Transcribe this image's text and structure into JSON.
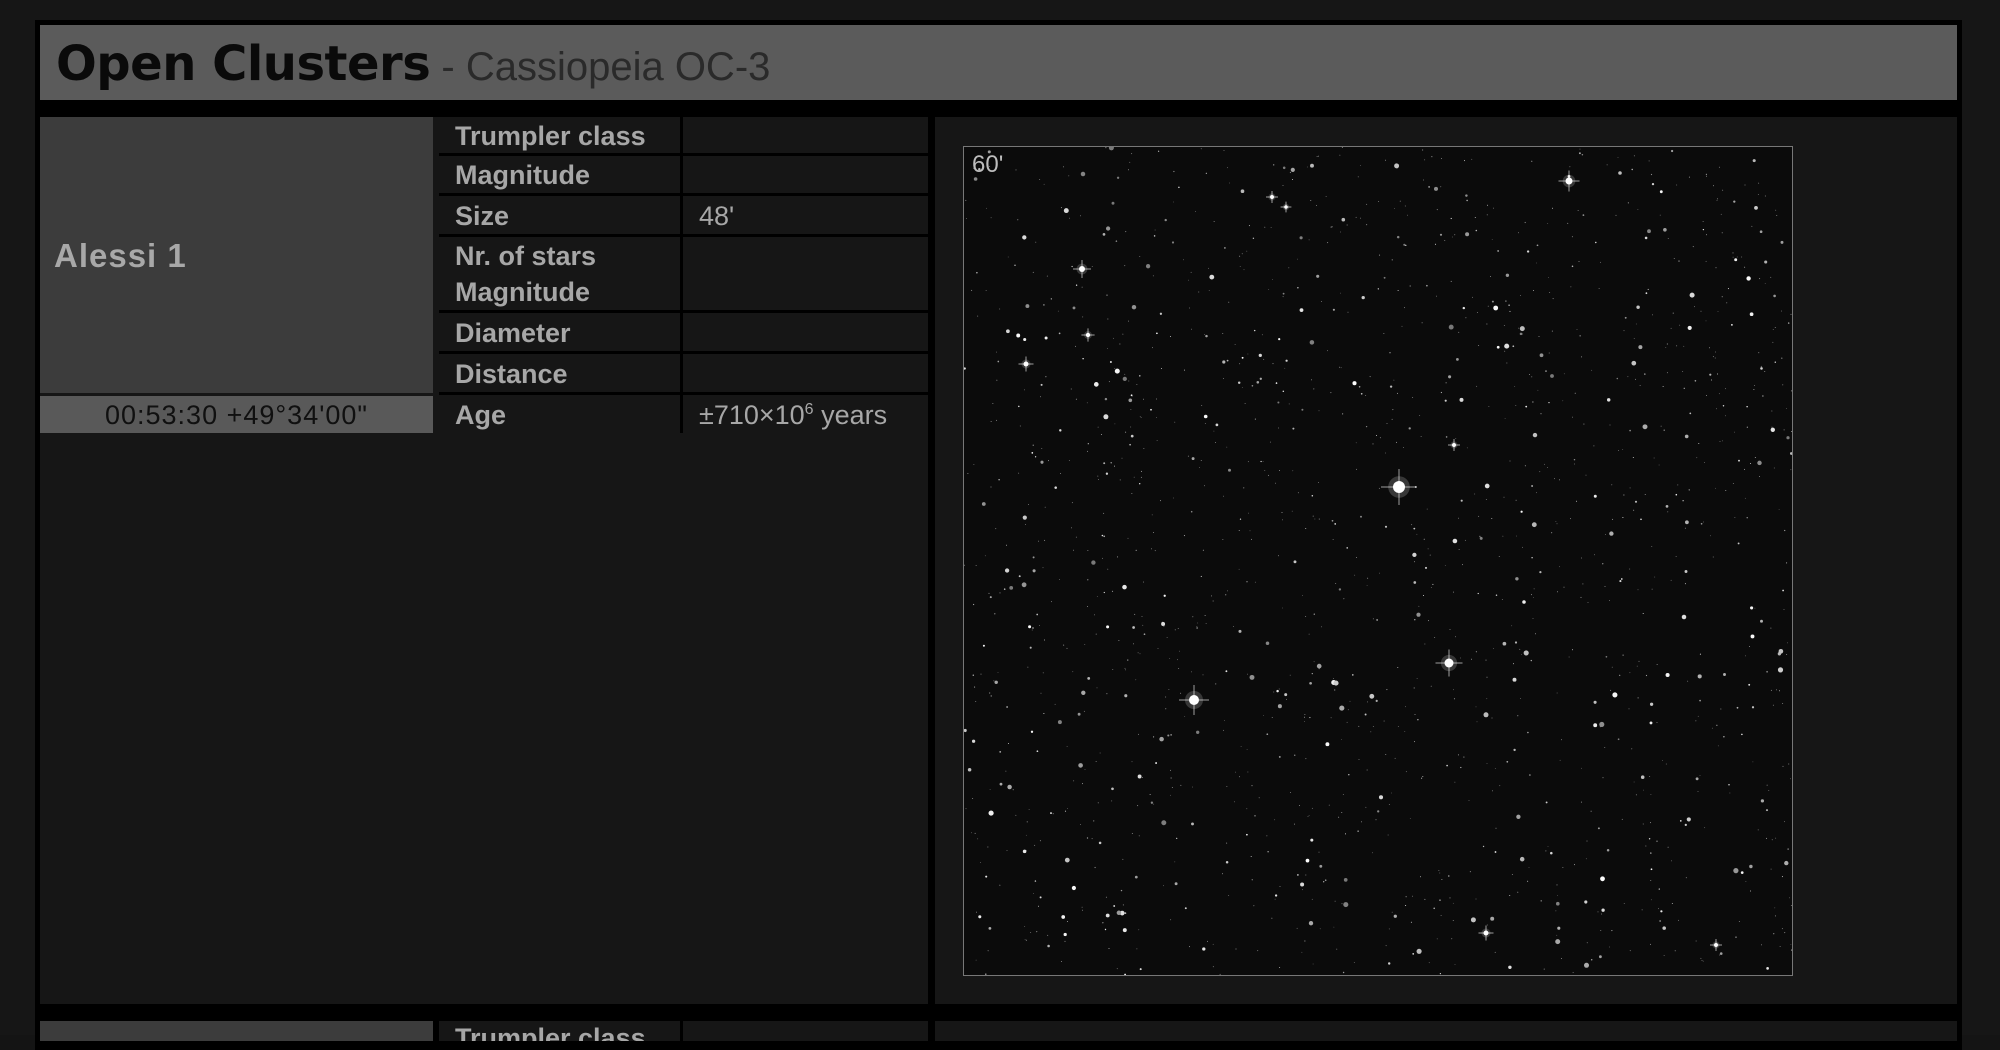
{
  "header": {
    "title": "Open Clusters",
    "subtitle": " - Cassiopeia OC-3"
  },
  "cluster": {
    "name": "Alessi 1",
    "coordinates": "00:53:30 +49°34'00\"",
    "properties": [
      {
        "label": "Trumpler class",
        "value": ""
      },
      {
        "label": "Magnitude",
        "value": ""
      },
      {
        "label": "Size",
        "value": "48'"
      },
      {
        "label": "Nr. of stars",
        "label2": "Magnitude",
        "value": ""
      },
      {
        "label": "Diameter",
        "value": ""
      },
      {
        "label": "Distance",
        "value": ""
      },
      {
        "label": "Age",
        "value_prefix": "±710×10",
        "value_sup": "6",
        "value_suffix": " years"
      }
    ],
    "image": {
      "field_of_view": "60'"
    }
  },
  "next_entry": {
    "first_label": "Trumpler class"
  }
}
